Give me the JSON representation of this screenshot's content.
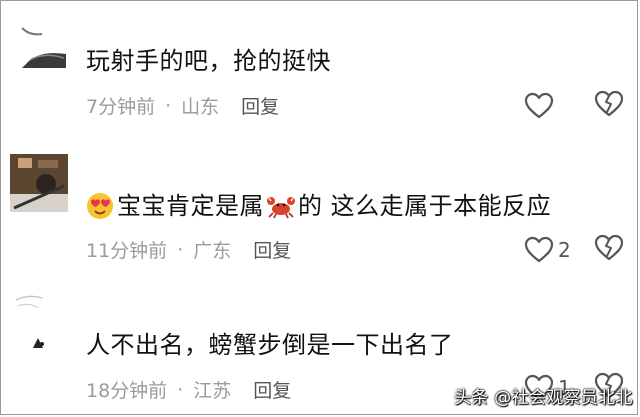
{
  "comments": [
    {
      "text": "玩射手的吧，抢的挺快",
      "time": "7分钟前",
      "location": "山东",
      "reply_label": "回复",
      "likes": ""
    },
    {
      "text_part1": "宝宝肯定是属",
      "text_part2": "的 这么走属于本能反应",
      "time": "11分钟前",
      "location": "广东",
      "reply_label": "回复",
      "likes": "2"
    },
    {
      "text": "人不出名，螃蟹步倒是一下出名了",
      "time": "18分钟前",
      "location": "江苏",
      "reply_label": "回复",
      "likes": "1"
    }
  ],
  "separator": "·",
  "watermark": "头条 @社会观察员北北",
  "colors": {
    "text": "#111111",
    "meta": "#9b9b9b",
    "reply": "#555555"
  },
  "icons": {
    "like": "heart-outline-icon",
    "dislike": "broken-heart-icon",
    "emoji_love": "heart-eyes-emoji-icon",
    "emoji_crab": "crab-emoji-icon"
  }
}
